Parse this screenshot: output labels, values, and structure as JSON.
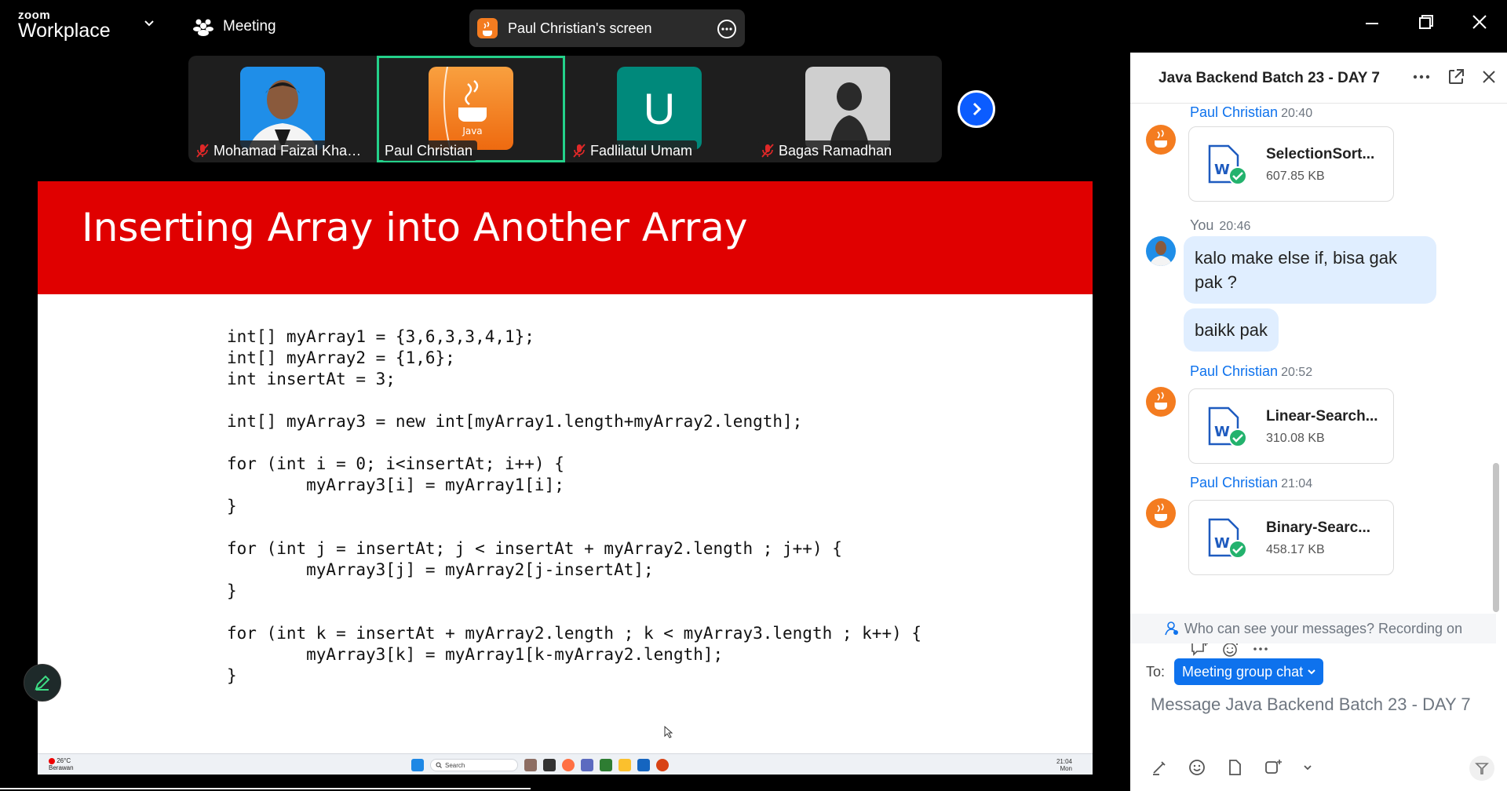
{
  "app": {
    "logo_line1": "zoom",
    "logo_line2": "Workplace",
    "meeting_label": "Meeting",
    "share_label": "Paul Christian's screen"
  },
  "participants": [
    {
      "name": "Mohamad Faizal Kham...",
      "muted": true,
      "avatar": "photo-man-blue"
    },
    {
      "name": "Paul Christian",
      "muted": false,
      "avatar": "java-logo",
      "active": true
    },
    {
      "name": "Fadlilatul Umam",
      "muted": true,
      "avatar": "letter",
      "initial": "U"
    },
    {
      "name": "Bagas Ramadhan",
      "muted": true,
      "avatar": "photo-silhouette"
    }
  ],
  "slide": {
    "title": "Inserting Array into Another Array",
    "code": "int[] myArray1 = {3,6,3,3,4,1};\nint[] myArray2 = {1,6};\nint insertAt = 3;\n\nint[] myArray3 = new int[myArray1.length+myArray2.length];\n\nfor (int i = 0; i<insertAt; i++) {\n        myArray3[i] = myArray1[i];\n}\n\nfor (int j = insertAt; j < insertAt + myArray2.length ; j++) {\n        myArray3[j] = myArray2[j-insertAt];\n}\n\nfor (int k = insertAt + myArray2.length ; k < myArray3.length ; k++) {\n        myArray3[k] = myArray1[k-myArray2.length];\n}",
    "taskbar": {
      "weather_temp": "26°C",
      "weather_desc": "Berawan",
      "search": "Search",
      "time": "21:04",
      "day": "Mon"
    }
  },
  "chat": {
    "title": "Java Backend Batch 23 - DAY 7",
    "messages": [
      {
        "sender": "Paul Christian",
        "time": "20:40",
        "file": "SelectionSort...",
        "size": "607.85 KB"
      },
      {
        "sender": "You",
        "time": "20:46",
        "texts": [
          "kalo make else if, bisa gak pak ?",
          "baikk pak"
        ]
      },
      {
        "sender": "Paul Christian",
        "time": "20:52",
        "file": "Linear-Search...",
        "size": "310.08 KB"
      },
      {
        "sender": "Paul Christian",
        "time": "21:04",
        "file": "Binary-Searc...",
        "size": "458.17 KB"
      }
    ],
    "notice": "Who can see your messages? Recording on",
    "to_label": "To:",
    "to_target": "Meeting group chat",
    "placeholder": "Message Java Backend Batch 23 - DAY 7"
  },
  "colors": {
    "accent": "#0e72ed",
    "slide_header": "#e00000",
    "active_tile": "#24d18a",
    "bubble": "#e0eeff"
  }
}
